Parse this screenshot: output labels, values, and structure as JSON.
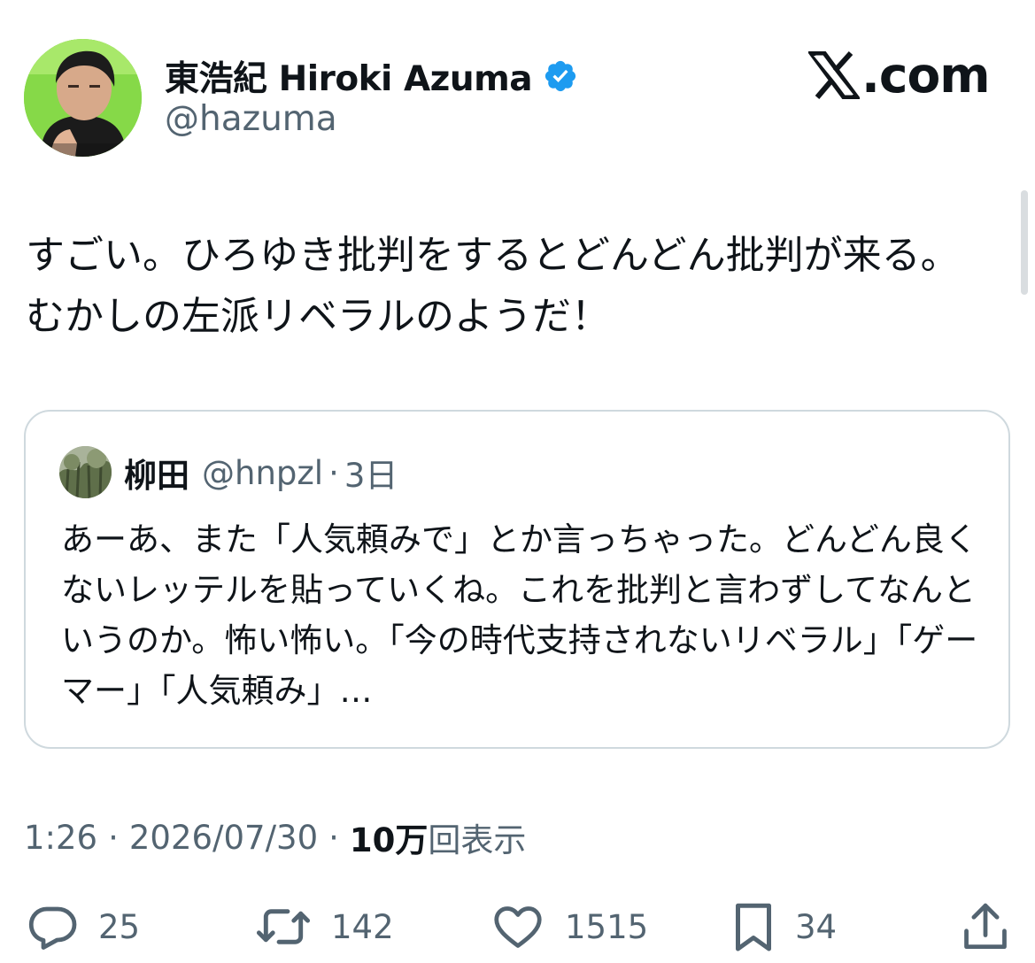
{
  "author": {
    "display_name": "東浩紀 Hiroki Azuma",
    "handle": "@hazuma",
    "verified": true,
    "verified_color": "#1d9bf0"
  },
  "brand": {
    "label": ".com",
    "icon": "x-logo-icon"
  },
  "tweet": {
    "text": "すごい。ひろゆき批判をするとどんどん批判が来る。むかしの左派リベラルのようだ！"
  },
  "quoted_tweet": {
    "display_name": "柳田",
    "handle": "@hnpzl",
    "separator": "·",
    "time": "3日",
    "text": "あーあ、また「人気頼みで」とか言っちゃった。どんどん良くないレッテルを貼っていくね。これを批判と言わずしてなんというのか。怖い怖い。「今の時代支持されないリベラル」「ゲーマー」「人気頼み」…"
  },
  "meta": {
    "time": "1:26",
    "separator": "·",
    "date": "2026/07/30",
    "views_count": "10万",
    "views_label": "回表示"
  },
  "actions": {
    "replies": {
      "icon": "reply-icon",
      "count": "25"
    },
    "reposts": {
      "icon": "repost-icon",
      "count": "142"
    },
    "likes": {
      "icon": "like-icon",
      "count": "1515"
    },
    "bookmarks": {
      "icon": "bookmark-icon",
      "count": "34"
    },
    "share": {
      "icon": "share-icon"
    }
  },
  "colors": {
    "text_primary": "#0f1419",
    "text_secondary": "#536471",
    "border": "#cfd9de",
    "accent": "#1d9bf0"
  }
}
